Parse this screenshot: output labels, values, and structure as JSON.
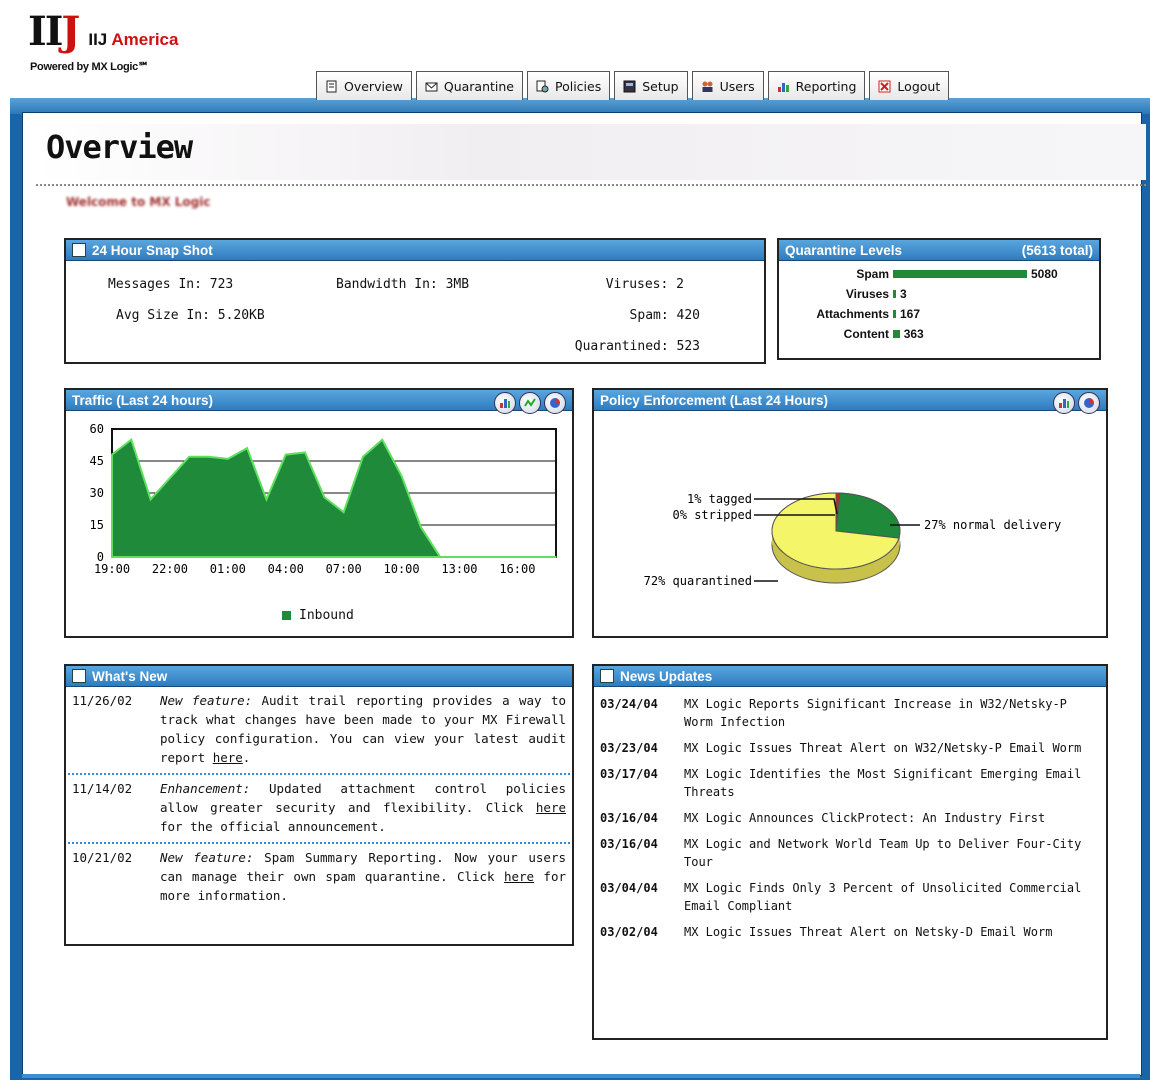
{
  "brand": {
    "mark_l": "II",
    "mark_j": "J",
    "name_a": "IIJ ",
    "name_b": "America",
    "powered": "Powered by MX Logic℠"
  },
  "nav": {
    "tabs": [
      {
        "label": "Overview",
        "icon": "document-icon"
      },
      {
        "label": "Quarantine",
        "icon": "envelope-icon"
      },
      {
        "label": "Policies",
        "icon": "policies-icon"
      },
      {
        "label": "Setup",
        "icon": "setup-icon"
      },
      {
        "label": "Users",
        "icon": "users-icon"
      },
      {
        "label": "Reporting",
        "icon": "reporting-icon"
      },
      {
        "label": "Logout",
        "icon": "logout-icon"
      }
    ]
  },
  "page": {
    "title": "Overview",
    "welcome": "Welcome to MX Logic"
  },
  "snapshot": {
    "title": "24 Hour Snap Shot",
    "messages_in": "Messages In:  723",
    "avg_size": "Avg Size In:  5.20KB",
    "bandwidth_in": "Bandwidth In:  3MB",
    "viruses": "Viruses:  2",
    "spam": "Spam:  420",
    "quarantined": "Quarantined:  523"
  },
  "quarantine_levels": {
    "title": "Quarantine Levels",
    "total": "(5613 total)",
    "rows": [
      {
        "label": "Spam",
        "value": "5080",
        "fraction": 1.0
      },
      {
        "label": "Viruses",
        "value": "3",
        "fraction": 0.01
      },
      {
        "label": "Attachments",
        "value": "167",
        "fraction": 0.02
      },
      {
        "label": "Content",
        "value": "363",
        "fraction": 0.05
      }
    ],
    "bar_color": "#1f8a3a"
  },
  "traffic": {
    "title": "Traffic (Last 24 hours)",
    "legend": "Inbound",
    "icons": [
      "bar-chart-icon",
      "line-chart-icon",
      "pie-chart-icon"
    ]
  },
  "policy": {
    "title": "Policy Enforcement (Last 24 Hours)",
    "icons": [
      "bar-chart-icon",
      "pie-chart-icon"
    ],
    "labels": [
      "1% tagged",
      "0% stripped",
      "27% normal delivery",
      "72% quarantined"
    ]
  },
  "chart_data": [
    {
      "type": "area",
      "title": "Traffic (Last 24 hours)",
      "x": [
        "19:00",
        "20:00",
        "21:00",
        "22:00",
        "23:00",
        "00:00",
        "01:00",
        "02:00",
        "03:00",
        "04:00",
        "05:00",
        "06:00",
        "07:00",
        "08:00",
        "09:00",
        "10:00",
        "11:00",
        "12:00",
        "13:00",
        "14:00",
        "15:00",
        "16:00",
        "17:00",
        "18:00"
      ],
      "xticks": [
        "19:00",
        "22:00",
        "01:00",
        "04:00",
        "07:00",
        "10:00",
        "13:00",
        "16:00"
      ],
      "series": [
        {
          "name": "Inbound",
          "values": [
            48,
            55,
            27,
            37,
            47,
            47,
            46,
            51,
            27,
            48,
            49,
            28,
            21,
            47,
            55,
            38,
            14,
            0,
            0,
            0,
            0,
            0,
            0,
            0
          ]
        }
      ],
      "ylim": [
        0,
        60
      ],
      "yticks": [
        0,
        15,
        30,
        45,
        60
      ],
      "color": "#1f8a3a",
      "grid": true
    },
    {
      "type": "pie",
      "title": "Policy Enforcement (Last 24 Hours)",
      "labels": [
        "tagged",
        "stripped",
        "normal delivery",
        "quarantined"
      ],
      "values": [
        1,
        0,
        27,
        72
      ],
      "colors": [
        "#cc2222",
        "#7777cc",
        "#1f8a3a",
        "#f5f56a"
      ]
    }
  ],
  "whats_new": {
    "title": "What's New",
    "items": [
      {
        "date": "11/26/02",
        "tag": "New feature:",
        "text": " Audit trail reporting provides a way to track what changes have been made to your MX Firewall policy configuration. You can view your latest audit report ",
        "link": "here",
        "after": "."
      },
      {
        "date": "11/14/02",
        "tag": "Enhancement:",
        "text": " Updated attachment control policies allow greater security and flexibility. Click ",
        "link": "here",
        "after": " for the official announcement."
      },
      {
        "date": "10/21/02",
        "tag": "New feature:",
        "text": " Spam Summary Reporting. Now your users can manage their own spam quarantine. Click ",
        "link": "here",
        "after": " for more information."
      }
    ]
  },
  "news": {
    "title": "News Updates",
    "items": [
      {
        "date": "03/24/04",
        "text": "MX Logic Reports Significant Increase in W32/Netsky-P Worm Infection"
      },
      {
        "date": "03/23/04",
        "text": "MX Logic Issues Threat Alert on W32/Netsky-P Email Worm"
      },
      {
        "date": "03/17/04",
        "text": "MX Logic Identifies the Most Significant Emerging Email Threats"
      },
      {
        "date": "03/16/04",
        "text": "MX Logic Announces ClickProtect: An Industry First"
      },
      {
        "date": "03/16/04",
        "text": "MX Logic and Network World Team Up to Deliver Four-City Tour"
      },
      {
        "date": "03/04/04",
        "text": "MX Logic Finds Only 3 Percent of Unsolicited Commercial Email Compliant"
      },
      {
        "date": "03/02/04",
        "text": "MX Logic Issues Threat Alert on Netsky-D Email Worm"
      }
    ]
  }
}
